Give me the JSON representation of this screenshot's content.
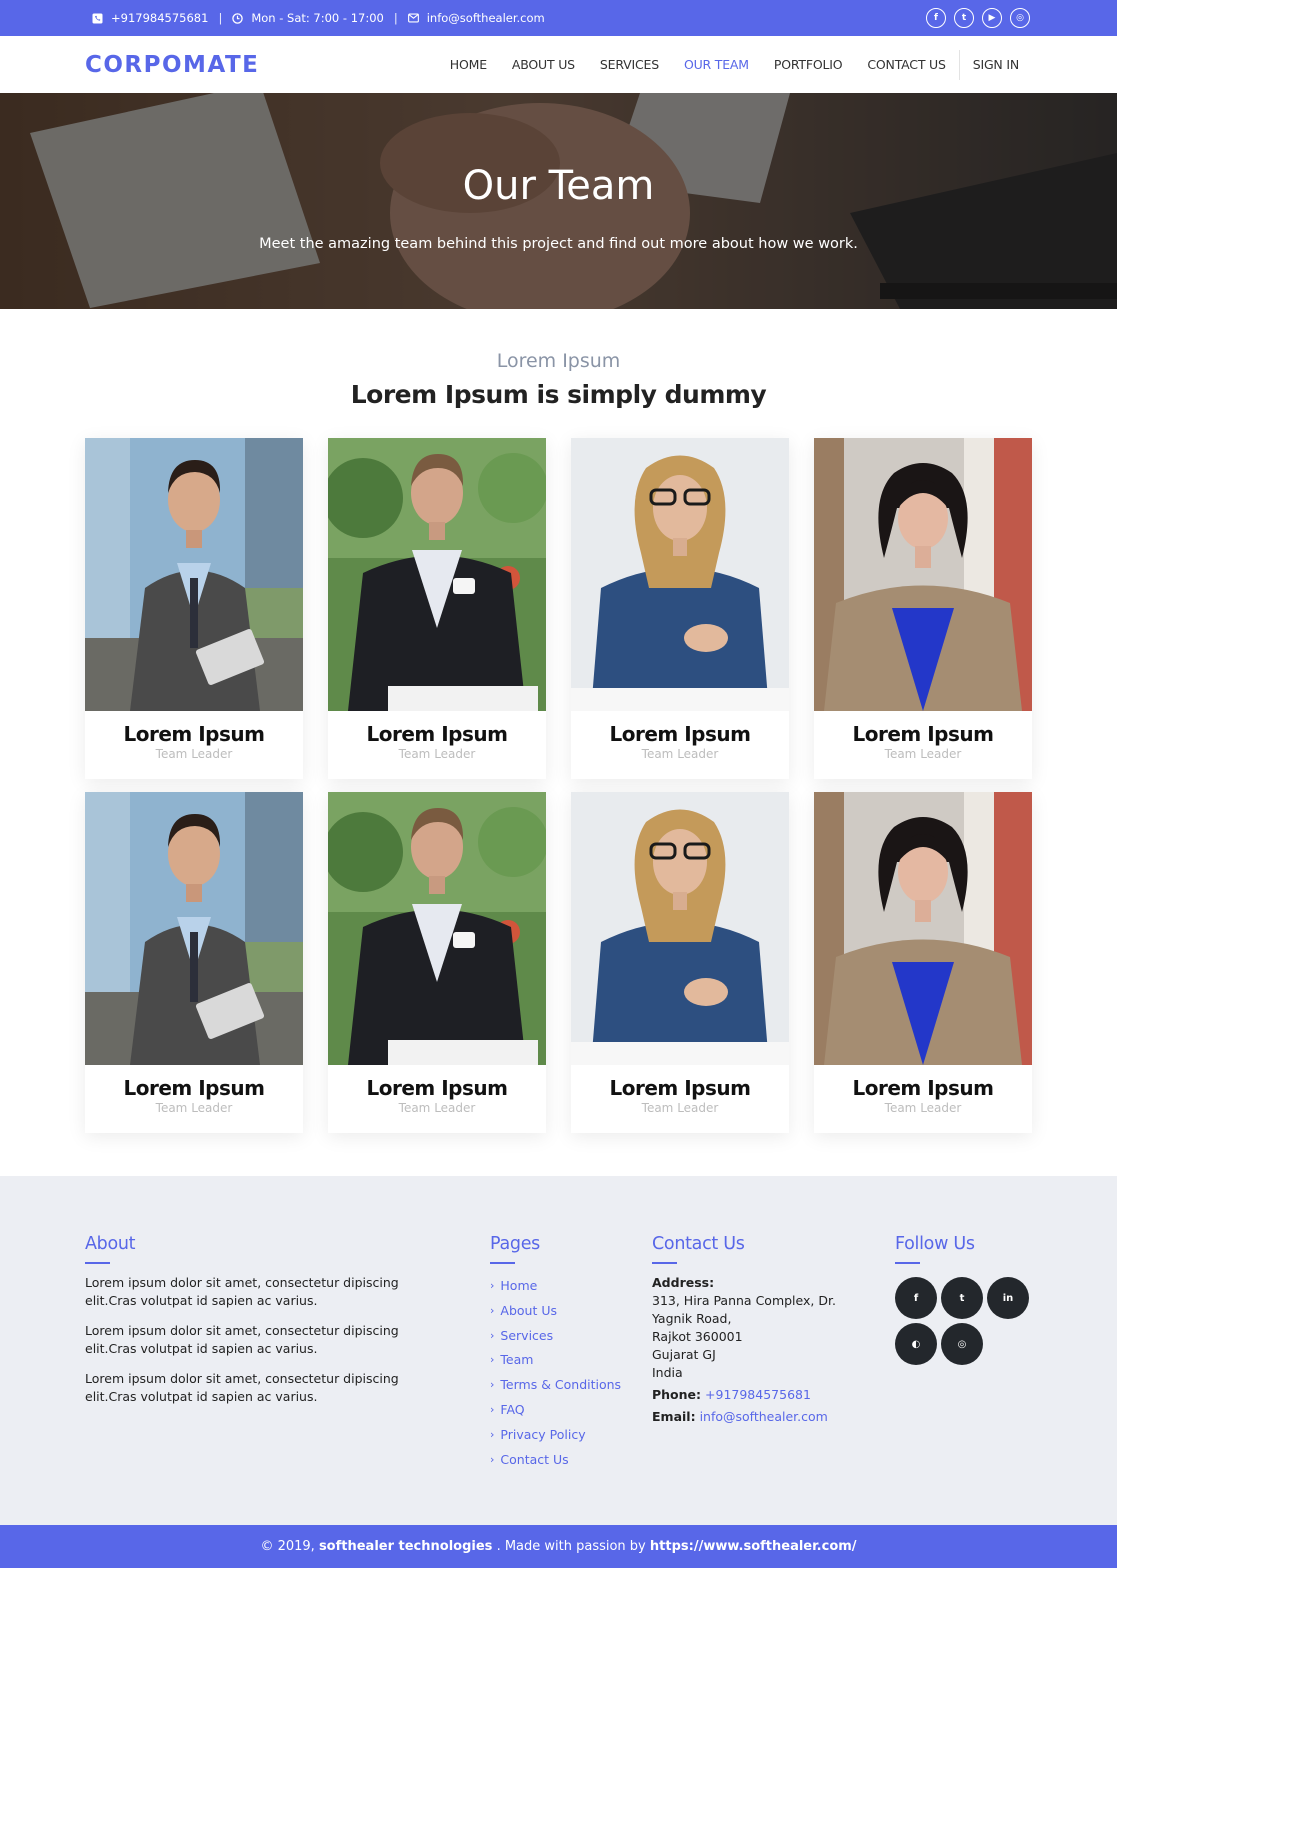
{
  "topbar": {
    "phone": "+917984575681",
    "hours": "Mon - Sat: 7:00 - 17:00",
    "email": "info@softhealer.com",
    "separator": "|",
    "socials": [
      {
        "icon": "facebook-icon",
        "glyph": "f"
      },
      {
        "icon": "twitter-icon",
        "glyph": "t"
      },
      {
        "icon": "youtube-icon",
        "glyph": "▶"
      },
      {
        "icon": "instagram-icon",
        "glyph": "◎"
      }
    ]
  },
  "navbar": {
    "logo": "CORPOMATE",
    "links": [
      "HOME",
      "ABOUT US",
      "SERVICES",
      "OUR TEAM",
      "PORTFOLIO",
      "CONTACT US"
    ],
    "active": "OUR TEAM",
    "signin": "SIGN IN"
  },
  "hero": {
    "title": "Our Team",
    "subtitle": "Meet the amazing team behind this project and find out more about how we work."
  },
  "section": {
    "subtitle": "Lorem Ipsum",
    "title": "Lorem Ipsum is simply dummy"
  },
  "team": [
    {
      "name": "Lorem Ipsum",
      "role": "Team Leader"
    },
    {
      "name": "Lorem Ipsum",
      "role": "Team Leader"
    },
    {
      "name": "Lorem Ipsum",
      "role": "Team Leader"
    },
    {
      "name": "Lorem Ipsum",
      "role": "Team Leader"
    },
    {
      "name": "Lorem Ipsum",
      "role": "Team Leader"
    },
    {
      "name": "Lorem Ipsum",
      "role": "Team Leader"
    },
    {
      "name": "Lorem Ipsum",
      "role": "Team Leader"
    },
    {
      "name": "Lorem Ipsum",
      "role": "Team Leader"
    }
  ],
  "footer": {
    "about": {
      "title": "About",
      "paragraphs": [
        "Lorem ipsum dolor sit amet, consectetur dipiscing elit.Cras volutpat id sapien ac varius.",
        "Lorem ipsum dolor sit amet, consectetur dipiscing elit.Cras volutpat id sapien ac varius.",
        "Lorem ipsum dolor sit amet, consectetur dipiscing elit.Cras volutpat id sapien ac varius."
      ]
    },
    "pages": {
      "title": "Pages",
      "links": [
        "Home",
        "About Us",
        "Services",
        "Team",
        "Terms & Conditions",
        "FAQ",
        "Privacy Policy",
        "Contact Us"
      ]
    },
    "contact": {
      "title": "Contact Us",
      "address_label": "Address:",
      "address_lines": [
        "313, Hira Panna Complex, Dr. Yagnik Road,",
        "Rajkot 360001",
        "Gujarat GJ",
        "India"
      ],
      "phone_label": "Phone:",
      "phone": "+917984575681",
      "email_label": "Email:",
      "email": "info@softhealer.com"
    },
    "follow": {
      "title": "Follow Us",
      "icons": [
        {
          "icon": "facebook-icon",
          "glyph": "f"
        },
        {
          "icon": "twitter-icon",
          "glyph": "t"
        },
        {
          "icon": "linkedin-icon",
          "glyph": "in"
        },
        {
          "icon": "github-icon",
          "glyph": "◐"
        },
        {
          "icon": "instagram-icon",
          "glyph": "◎"
        }
      ]
    }
  },
  "copyright": {
    "prefix": "© 2019,",
    "company": "softhealer technologies",
    "middle": ". Made with passion by",
    "url": "https://www.softhealer.com/"
  },
  "colors": {
    "accent": "#5867e8",
    "footer_bg": "#eceef3",
    "dark_icon": "#23272c"
  }
}
